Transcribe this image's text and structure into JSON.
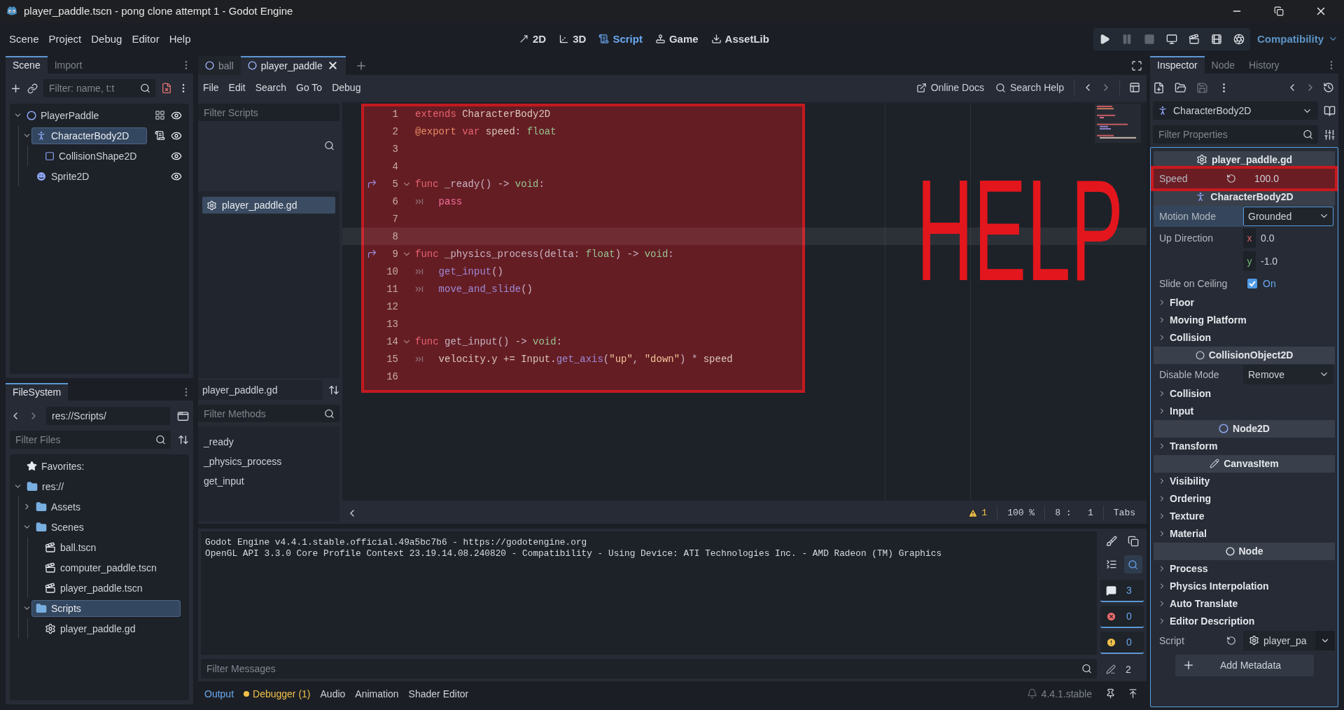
{
  "window": {
    "title": "player_paddle.tscn - pong clone attempt 1 - Godot Engine"
  },
  "menu": [
    "Scene",
    "Project",
    "Debug",
    "Editor",
    "Help"
  ],
  "workspaces": [
    {
      "label": "2D",
      "kind": "planar",
      "selected": false
    },
    {
      "label": "3D",
      "kind": "spatial",
      "selected": false
    },
    {
      "label": "Script",
      "kind": "script",
      "selected": true
    },
    {
      "label": "Game",
      "kind": "game",
      "selected": false
    },
    {
      "label": "AssetLib",
      "kind": "assetlib",
      "selected": false
    }
  ],
  "run_buttons": [
    {
      "kind": "play",
      "disabled": false
    },
    {
      "kind": "pause",
      "disabled": true
    },
    {
      "kind": "stop",
      "disabled": true
    },
    {
      "kind": "remote",
      "disabled": false
    },
    {
      "kind": "scene",
      "disabled": false
    },
    {
      "kind": "custom",
      "disabled": false
    },
    {
      "kind": "movie",
      "disabled": false
    }
  ],
  "renderer": "Compatibility",
  "scene_dock": {
    "tabs": [
      {
        "label": "Scene",
        "selected": true
      },
      {
        "label": "Import",
        "selected": false
      }
    ],
    "filter": {
      "placeholder": "Filter: name, t:t"
    },
    "tree": [
      {
        "name": "PlayerPaddle",
        "kind": "node2d",
        "grouped": true,
        "has_script": false,
        "visible": true,
        "selected": false,
        "expanded": true,
        "children": [
          {
            "name": "CharacterBody2D",
            "kind": "body",
            "grouped": false,
            "has_script": true,
            "visible": true,
            "selected": true,
            "expanded": true,
            "children": [
              {
                "name": "CollisionShape2D",
                "kind": "shape",
                "grouped": false,
                "has_script": false,
                "visible": true,
                "selected": false
              }
            ]
          },
          {
            "name": "Sprite2D",
            "kind": "sprite",
            "grouped": false,
            "has_script": false,
            "visible": true,
            "selected": false
          }
        ]
      }
    ]
  },
  "filesystem": {
    "tabs": [
      {
        "label": "FileSystem",
        "selected": true
      }
    ],
    "path": "res://Scripts/",
    "filter": {
      "placeholder": "Filter Files"
    },
    "favorites": "Favorites:",
    "tree": [
      {
        "name": "res://",
        "kind": "folder",
        "selected": false,
        "expanded": true,
        "children": [
          {
            "name": "Assets",
            "kind": "folder",
            "selected": false,
            "expanded": false
          },
          {
            "name": "Scenes",
            "kind": "folder",
            "selected": false,
            "expanded": true,
            "children": [
              {
                "name": "ball.tscn",
                "kind": "scene",
                "selected": false
              },
              {
                "name": "computer_paddle.tscn",
                "kind": "scene",
                "selected": false
              },
              {
                "name": "player_paddle.tscn",
                "kind": "scene",
                "selected": false
              }
            ]
          },
          {
            "name": "Scripts",
            "kind": "folder",
            "selected": true,
            "expanded": true,
            "children": [
              {
                "name": "player_paddle.gd",
                "kind": "script",
                "selected": false
              }
            ]
          }
        ]
      }
    ]
  },
  "script_tabs": [
    {
      "label": "ball",
      "selected": false
    },
    {
      "label": "player_paddle",
      "selected": true
    }
  ],
  "script_menu": [
    "File",
    "Edit",
    "Search",
    "Go To",
    "Debug"
  ],
  "help_links": [
    {
      "label": "Online Docs",
      "kind": "docs"
    },
    {
      "label": "Search Help",
      "kind": "search"
    }
  ],
  "scripts_panel": {
    "filter": {
      "placeholder": "Filter Scripts"
    },
    "scripts": [
      {
        "name": "player_paddle.gd",
        "selected": true
      }
    ],
    "current": "player_paddle.gd",
    "methods_filter": {
      "placeholder": "Filter Methods"
    },
    "methods": [
      "_ready",
      "_physics_process",
      "get_input"
    ]
  },
  "code": {
    "highlighted": true,
    "handwritten_note": "HELP",
    "lines": [
      {
        "number": "1",
        "current": false,
        "fold": false,
        "override": false,
        "indented": false,
        "tokens": [
          {
            "kind": "keyword",
            "text": "extends"
          },
          {
            "kind": "plain",
            "text": " CharacterBody2D"
          }
        ]
      },
      {
        "number": "2",
        "current": false,
        "fold": false,
        "override": false,
        "indented": false,
        "tokens": [
          {
            "kind": "annotation",
            "text": "@export"
          },
          {
            "kind": "keyword",
            "text": " var"
          },
          {
            "kind": "plain",
            "text": " speed"
          },
          {
            "kind": "symbol",
            "text": ": "
          },
          {
            "kind": "type",
            "text": "float"
          }
        ]
      },
      {
        "number": "3",
        "current": false,
        "fold": false,
        "override": false,
        "indented": false
      },
      {
        "number": "4",
        "current": false,
        "fold": false,
        "override": false,
        "indented": false
      },
      {
        "number": "5",
        "current": false,
        "fold": true,
        "override": true,
        "indented": false,
        "tokens": [
          {
            "kind": "keyword",
            "text": "func"
          },
          {
            "kind": "name",
            "text": " _ready"
          },
          {
            "kind": "symbol",
            "text": "() -> "
          },
          {
            "kind": "type",
            "text": "void"
          },
          {
            "kind": "symbol",
            "text": ":"
          }
        ]
      },
      {
        "number": "6",
        "current": false,
        "fold": false,
        "override": false,
        "indented": true,
        "tokens": [
          {
            "kind": "control",
            "text": "pass"
          }
        ]
      },
      {
        "number": "7",
        "current": false,
        "fold": false,
        "override": false,
        "indented": false
      },
      {
        "number": "8",
        "current": true,
        "fold": false,
        "override": false,
        "indented": false
      },
      {
        "number": "9",
        "current": false,
        "fold": true,
        "override": true,
        "indented": false,
        "tokens": [
          {
            "kind": "keyword",
            "text": "func"
          },
          {
            "kind": "name",
            "text": " _physics_process"
          },
          {
            "kind": "symbol",
            "text": "("
          },
          {
            "kind": "name",
            "text": "delta"
          },
          {
            "kind": "symbol",
            "text": ": "
          },
          {
            "kind": "type",
            "text": "float"
          },
          {
            "kind": "symbol",
            "text": ") -> "
          },
          {
            "kind": "type",
            "text": "void"
          },
          {
            "kind": "symbol",
            "text": ":"
          }
        ]
      },
      {
        "number": "10",
        "current": false,
        "fold": false,
        "override": false,
        "indented": true,
        "tokens": [
          {
            "kind": "function",
            "text": "get_input"
          },
          {
            "kind": "symbol",
            "text": "()"
          }
        ]
      },
      {
        "number": "11",
        "current": false,
        "fold": false,
        "override": false,
        "indented": true,
        "tokens": [
          {
            "kind": "function",
            "text": "move_and_slide"
          },
          {
            "kind": "symbol",
            "text": "()"
          }
        ]
      },
      {
        "number": "12",
        "current": false,
        "fold": false,
        "override": false,
        "indented": false
      },
      {
        "number": "13",
        "current": false,
        "fold": false,
        "override": false,
        "indented": false
      },
      {
        "number": "14",
        "current": false,
        "fold": true,
        "override": false,
        "indented": false,
        "tokens": [
          {
            "kind": "keyword",
            "text": "func"
          },
          {
            "kind": "name",
            "text": " get_input"
          },
          {
            "kind": "symbol",
            "text": "() -> "
          },
          {
            "kind": "type",
            "text": "void"
          },
          {
            "kind": "symbol",
            "text": ":"
          }
        ]
      },
      {
        "number": "15",
        "current": false,
        "fold": false,
        "override": false,
        "indented": true,
        "tokens": [
          {
            "kind": "plain",
            "text": "velocity.y += Input."
          },
          {
            "kind": "function",
            "text": "get_axis"
          },
          {
            "kind": "symbol",
            "text": "("
          },
          {
            "kind": "string",
            "text": "\"up\""
          },
          {
            "kind": "symbol",
            "text": ", "
          },
          {
            "kind": "string",
            "text": "\"down\""
          },
          {
            "kind": "symbol",
            "text": ") * "
          },
          {
            "kind": "plain",
            "text": "speed"
          }
        ]
      },
      {
        "number": "16",
        "current": false,
        "fold": false,
        "override": false,
        "indented": false
      }
    ]
  },
  "status": {
    "warnings": "1",
    "zoom": "100 %",
    "cursor": "8 :   1",
    "indent": "Tabs"
  },
  "output": {
    "lines": [
      "Godot Engine v4.4.1.stable.official.49a5bc7b6 - https://godotengine.org",
      "OpenGL API 3.3.0 Core Profile Context 23.19.14.08.240820 - Compatibility - Using Device: ATI Technologies Inc. - AMD Radeon (TM) Graphics"
    ],
    "tools": [
      {
        "kind": "clear",
        "on": false
      },
      {
        "kind": "copy",
        "on": false
      },
      {
        "kind": "collapse",
        "on": false
      },
      {
        "kind": "search",
        "on": true
      }
    ],
    "filters": [
      {
        "kind": "message",
        "count": "3",
        "on": true
      },
      {
        "kind": "error",
        "count": "0",
        "on": true
      },
      {
        "kind": "warning",
        "count": "0",
        "on": true
      },
      {
        "kind": "editor",
        "count": "2",
        "on": false
      }
    ],
    "filter": {
      "placeholder": "Filter Messages"
    }
  },
  "bottom_tabs": [
    {
      "label": "Output",
      "selected": true,
      "alert": false
    },
    {
      "label": "Debugger (1)",
      "selected": false,
      "alert": true
    },
    {
      "label": "Audio",
      "selected": false,
      "alert": false
    },
    {
      "label": "Animation",
      "selected": false,
      "alert": false
    },
    {
      "label": "Shader Editor",
      "selected": false,
      "alert": false
    }
  ],
  "version": "4.4.1.stable",
  "inspector": {
    "tabs": [
      {
        "label": "Inspector",
        "selected": true
      },
      {
        "label": "Node",
        "selected": false
      },
      {
        "label": "History",
        "selected": false
      }
    ],
    "object": {
      "name": "CharacterBody2D",
      "kind": "body"
    },
    "filter": {
      "placeholder": "Filter Properties"
    },
    "sections": [
      {
        "title": "player_paddle.gd",
        "kind": "script",
        "rows": [
          {
            "kind": "number",
            "label": "Speed",
            "value": "100.0",
            "revertable": true,
            "selected": false,
            "highlighted": true
          }
        ]
      },
      {
        "title": "CharacterBody2D",
        "kind": "body",
        "rows": [
          {
            "kind": "enum",
            "label": "Motion Mode",
            "value": "Grounded",
            "revertable": false,
            "selected": true,
            "highlighted": false
          },
          {
            "kind": "vector",
            "label": "Up Direction",
            "components": [
              {
                "axis": "x",
                "value": "0.0"
              },
              {
                "axis": "y",
                "value": "-1.0"
              }
            ],
            "revertable": false,
            "selected": false,
            "highlighted": false
          },
          {
            "kind": "check",
            "label": "Slide on Ceiling",
            "value": "On",
            "checked": true,
            "revertable": false,
            "selected": false,
            "highlighted": false
          },
          {
            "kind": "group",
            "label": "Floor",
            "expanded": false
          },
          {
            "kind": "group",
            "label": "Moving Platform",
            "expanded": false
          },
          {
            "kind": "group",
            "label": "Collision",
            "expanded": false
          }
        ]
      },
      {
        "title": "CollisionObject2D",
        "kind": "collision",
        "rows": [
          {
            "kind": "enum",
            "label": "Disable Mode",
            "value": "Remove",
            "revertable": false,
            "selected": false,
            "highlighted": false
          },
          {
            "kind": "group",
            "label": "Collision",
            "expanded": false
          },
          {
            "kind": "group",
            "label": "Input",
            "expanded": false
          }
        ]
      },
      {
        "title": "Node2D",
        "kind": "node2d",
        "rows": [
          {
            "kind": "group",
            "label": "Transform",
            "expanded": false
          }
        ]
      },
      {
        "title": "CanvasItem",
        "kind": "canvas",
        "rows": [
          {
            "kind": "group",
            "label": "Visibility",
            "expanded": false
          },
          {
            "kind": "group",
            "label": "Ordering",
            "expanded": false
          },
          {
            "kind": "group",
            "label": "Texture",
            "expanded": false
          },
          {
            "kind": "group",
            "label": "Material",
            "expanded": false
          }
        ]
      },
      {
        "title": "Node",
        "kind": "node",
        "rows": [
          {
            "kind": "group",
            "label": "Process",
            "expanded": false
          },
          {
            "kind": "group",
            "label": "Physics Interpolation",
            "expanded": false
          },
          {
            "kind": "group",
            "label": "Auto Translate",
            "expanded": false
          },
          {
            "kind": "group",
            "label": "Editor Description",
            "expanded": false
          },
          {
            "kind": "resource",
            "label": "Script",
            "value": "player_pa",
            "revertable": true,
            "selected": false,
            "highlighted": false
          }
        ]
      }
    ],
    "add_button": "Add Metadata"
  }
}
